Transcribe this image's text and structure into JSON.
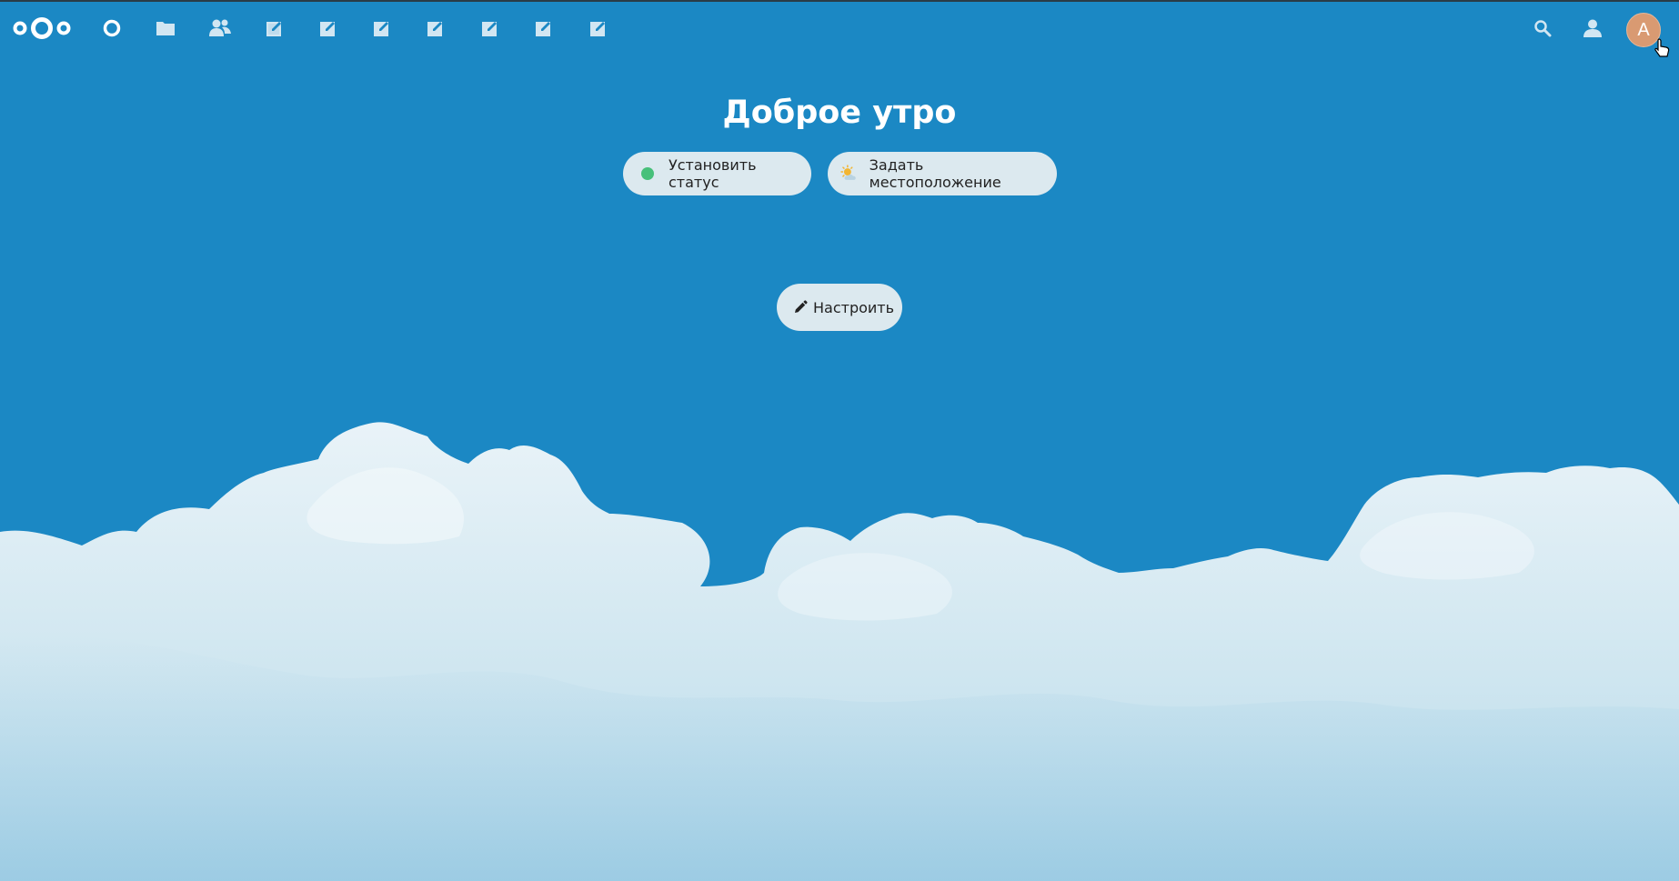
{
  "header": {
    "logo_icon": "nextcloud-logo",
    "apps": [
      {
        "name": "dashboard",
        "icon": "dashboard-icon"
      },
      {
        "name": "files",
        "icon": "folder-icon"
      },
      {
        "name": "contacts",
        "icon": "contacts-icon"
      },
      {
        "name": "app-1",
        "icon": "edit-icon"
      },
      {
        "name": "app-2",
        "icon": "edit-icon"
      },
      {
        "name": "app-3",
        "icon": "edit-icon"
      },
      {
        "name": "app-4",
        "icon": "edit-icon"
      },
      {
        "name": "app-5",
        "icon": "edit-icon"
      },
      {
        "name": "app-6",
        "icon": "edit-icon"
      },
      {
        "name": "app-7",
        "icon": "edit-icon"
      }
    ],
    "search_icon": "search-icon",
    "contacts_menu_icon": "contacts-menu-icon",
    "avatar_initial": "A"
  },
  "main": {
    "greeting": "Доброе утро",
    "status_button_label": "Установить статус",
    "status_color": "#47c07a",
    "location_button_label": "Задать местоположение",
    "customize_button_label": "Настроить"
  },
  "colors": {
    "background": "#1b88c4",
    "pill_background": "#dce9ef",
    "avatar": "#d99a72"
  }
}
